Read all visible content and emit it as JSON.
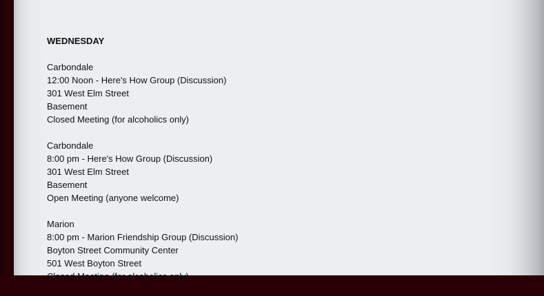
{
  "day": "WEDNESDAY",
  "meetings": [
    {
      "city": "Carbondale",
      "title": "12:00 Noon - Here's How Group (Discussion)",
      "address": "301 West Elm Street",
      "location": "Basement",
      "type": "Closed Meeting (for alcoholics only)"
    },
    {
      "city": "Carbondale",
      "title": "8:00 pm - Here's How Group (Discussion)",
      "address": "301 West Elm Street",
      "location": "Basement",
      "type": "Open Meeting (anyone welcome)"
    },
    {
      "city": "Marion",
      "title": "8:00 pm - Marion Friendship Group (Discussion)",
      "location": "Boyton Street Community Center",
      "address": "501 West Boyton Street",
      "type": "Closed Meeting (for alcoholics only)"
    }
  ]
}
